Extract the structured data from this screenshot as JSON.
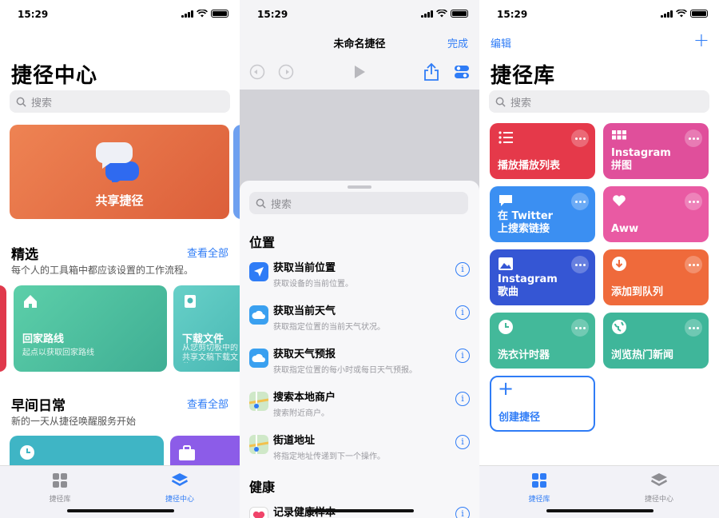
{
  "status": {
    "time": "15:29"
  },
  "gallery": {
    "title": "捷径中心",
    "search_placeholder": "搜索",
    "banner_label": "共享捷径",
    "featured": {
      "title": "精选",
      "see_all": "查看全部",
      "subtitle": "每个人的工具箱中都应该设置的工作流程。",
      "cards": [
        {
          "title": "回家路线",
          "subtitle": "起点以获取回家路线"
        },
        {
          "title": "下载文件",
          "subtitle": "从您剪切板中的共享文稿下载文件"
        }
      ]
    },
    "morning": {
      "title": "早间日常",
      "see_all": "查看全部",
      "subtitle": "新的一天从捷径唤醒服务开始"
    },
    "tabs": [
      {
        "label": "捷径库"
      },
      {
        "label": "捷径中心"
      }
    ]
  },
  "editor": {
    "title": "未命名捷径",
    "done": "完成",
    "search_placeholder": "搜索",
    "sections": [
      {
        "title": "位置",
        "items": [
          {
            "title": "获取当前位置",
            "subtitle": "获取设备的当前位置。"
          },
          {
            "title": "获取当前天气",
            "subtitle": "获取指定位置的当前天气状况。"
          },
          {
            "title": "获取天气预报",
            "subtitle": "获取指定位置的每小时或每日天气预报。"
          },
          {
            "title": "搜索本地商户",
            "subtitle": "搜索附近商户。"
          },
          {
            "title": "街道地址",
            "subtitle": "将指定地址传递到下一个操作。"
          }
        ]
      },
      {
        "title": "健康",
        "items": [
          {
            "title": "记录健康样本",
            "subtitle": ""
          }
        ]
      }
    ],
    "info_glyph": "i"
  },
  "library": {
    "edit": "编辑",
    "add": "+",
    "title": "捷径库",
    "search_placeholder": "搜索",
    "tiles": [
      {
        "label": "播放播放列表",
        "icon": "list-icon",
        "color": "#e5394a"
      },
      {
        "label": "Instagram\n拼图",
        "icon": "grid-icon",
        "color": "#e04f9b"
      },
      {
        "label": "在 Twitter\n上搜索链接",
        "icon": "chat-bubble-icon",
        "color": "#3b8ff2"
      },
      {
        "label": "Aww",
        "icon": "heart-icon",
        "color": "#e95aa3"
      },
      {
        "label": "Instagram\n歌曲",
        "icon": "image-icon",
        "color": "#3556d4"
      },
      {
        "label": "添加到队列",
        "icon": "download-icon",
        "color": "#ef6a3b"
      },
      {
        "label": "洗衣计时器",
        "icon": "clock-icon",
        "color": "#43b99a"
      },
      {
        "label": "浏览热门新闻",
        "icon": "globe-icon",
        "color": "#3fb69a"
      }
    ],
    "create_label": "创建捷径",
    "create_plus": "+",
    "tabs": [
      {
        "label": "捷径库"
      },
      {
        "label": "捷径中心"
      }
    ]
  },
  "colors": {
    "accent": "#2f7cf6",
    "banner": "#e86f47",
    "route_card": "#4cc3a0",
    "download_card": "#58c6c0"
  }
}
